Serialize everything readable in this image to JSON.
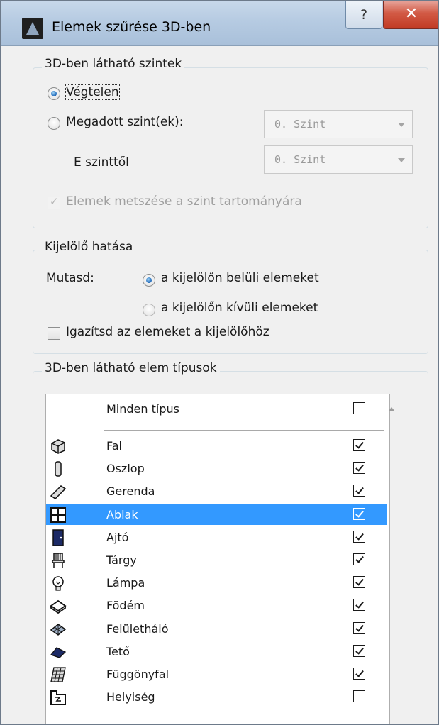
{
  "window": {
    "title": "Elemek szűrése 3D-ben",
    "help_label": "?",
    "close_label": "✕"
  },
  "levels_group": {
    "title": "3D-ben látható szintek",
    "option_infinite": "Végtelen",
    "option_specified": "Megadott szint(ek):",
    "from_level_label": "E szinttől",
    "level_combo_1": "0. Szint",
    "level_combo_2": "0. Szint",
    "cut_checkbox_label": "Elemek metszése a szint tartományára",
    "selected_option": "Végtelen",
    "cut_checked": true,
    "specified_enabled": false
  },
  "marquee_group": {
    "title": "Kijelölő hatása",
    "show_label": "Mutasd:",
    "option_inside": "a kijelölőn belüli elemeket",
    "option_outside": "a kijelölőn kívüli elemeket",
    "selected_option": "a kijelölőn belüli elemeket",
    "fit_checkbox_label": "Igazítsd az elemeket a kijelölőhöz",
    "fit_checked": false
  },
  "types_group": {
    "title": "3D-ben látható elem típusok",
    "all_types_label": "Minden típus",
    "all_types_checked": false,
    "selected_item": "Ablak",
    "selection_color": "#3399ff",
    "items": [
      {
        "label": "Fal",
        "icon": "wall-icon",
        "checked": true
      },
      {
        "label": "Oszlop",
        "icon": "column-icon",
        "checked": true
      },
      {
        "label": "Gerenda",
        "icon": "beam-icon",
        "checked": true
      },
      {
        "label": "Ablak",
        "icon": "window-icon",
        "checked": true
      },
      {
        "label": "Ajtó",
        "icon": "door-icon",
        "checked": true
      },
      {
        "label": "Tárgy",
        "icon": "object-icon",
        "checked": true
      },
      {
        "label": "Lámpa",
        "icon": "lamp-icon",
        "checked": true
      },
      {
        "label": "Födém",
        "icon": "slab-icon",
        "checked": true
      },
      {
        "label": "Felületháló",
        "icon": "mesh-icon",
        "checked": true
      },
      {
        "label": "Tető",
        "icon": "roof-icon",
        "checked": true
      },
      {
        "label": "Függönyfal",
        "icon": "curtain-wall-icon",
        "checked": true
      },
      {
        "label": "Helyiség",
        "icon": "zone-icon",
        "checked": false
      }
    ]
  }
}
